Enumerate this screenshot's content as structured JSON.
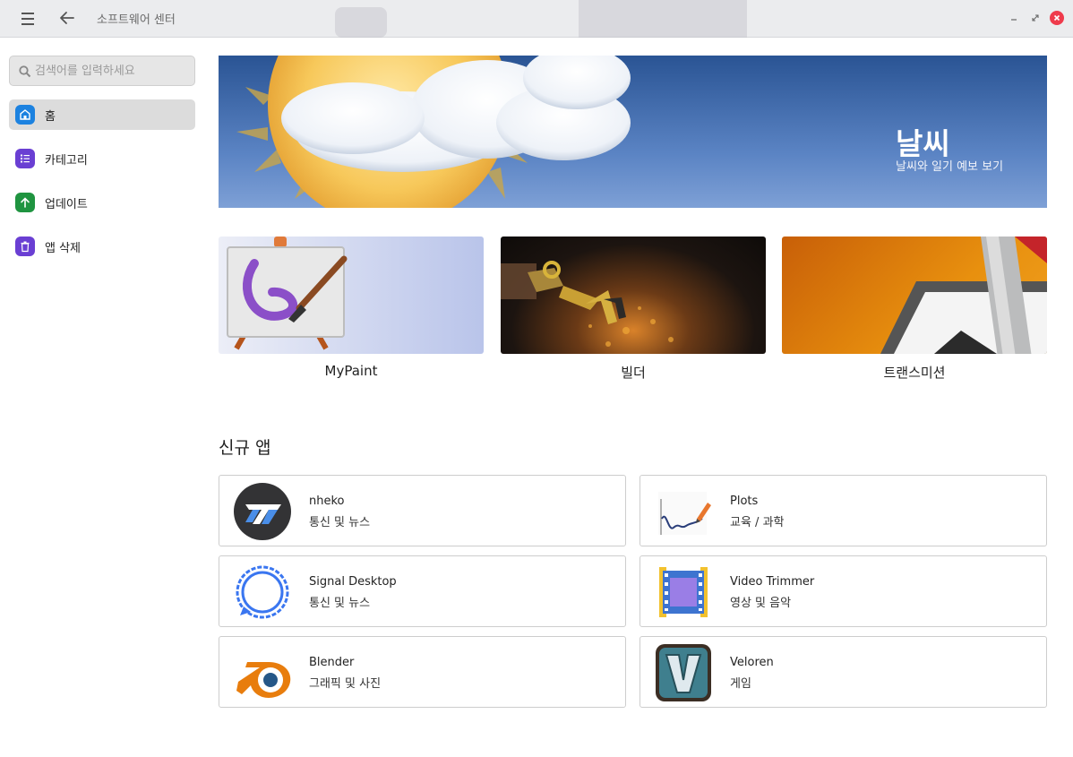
{
  "window": {
    "title": "소프트웨어 센터"
  },
  "search": {
    "placeholder": "검색어를 입력하세요"
  },
  "sidebar": {
    "items": [
      {
        "label": "홈",
        "icon": "home-icon",
        "color": "#1c82e0"
      },
      {
        "label": "카테고리",
        "icon": "list-icon",
        "color": "#6a3fd3"
      },
      {
        "label": "업데이트",
        "icon": "arrow-up-icon",
        "color": "#1f9440"
      },
      {
        "label": "앱 삭제",
        "icon": "trash-icon",
        "color": "#6a3fd3"
      }
    ]
  },
  "banner": {
    "title": "날씨",
    "subtitle": "날씨와 일기 예보 보기"
  },
  "featured": [
    {
      "label": "MyPaint"
    },
    {
      "label": "빌더"
    },
    {
      "label": "트랜스미션"
    }
  ],
  "new_apps": {
    "title": "신규 앱",
    "apps": [
      {
        "name": "nheko",
        "category": "통신 및 뉴스",
        "icon": "nheko-icon"
      },
      {
        "name": "Plots",
        "category": "교육 / 과학",
        "icon": "plots-icon"
      },
      {
        "name": "Signal Desktop",
        "category": "통신 및 뉴스",
        "icon": "signal-icon"
      },
      {
        "name": "Video Trimmer",
        "category": "영상 및 음악",
        "icon": "video-trimmer-icon"
      },
      {
        "name": "Blender",
        "category": "그래픽 및 사진",
        "icon": "blender-icon"
      },
      {
        "name": "Veloren",
        "category": "게임",
        "icon": "veloren-icon"
      }
    ]
  }
}
